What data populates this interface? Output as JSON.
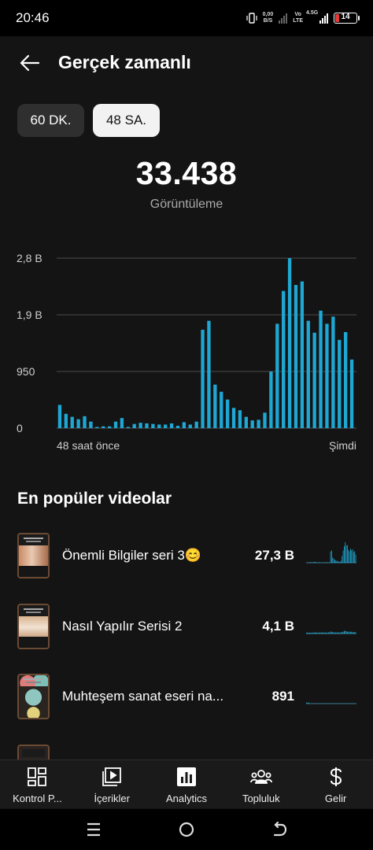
{
  "status_bar": {
    "time": "20:46",
    "net_speed_value": "0,00",
    "net_speed_unit": "B/S",
    "volte_top": "Vo",
    "volte_bottom": "LTE",
    "network_type": "4.5G",
    "battery_level": "14",
    "battery_color": "#e53935"
  },
  "header": {
    "back_icon": "arrow-left-icon",
    "title": "Gerçek zamanlı"
  },
  "range_chips": {
    "minutes_label": "60 DK.",
    "hours_label": "48 SA.",
    "selected": "48 SA."
  },
  "summary": {
    "total_views": "33.438",
    "total_views_label": "Görüntüleme"
  },
  "chart_data": {
    "type": "bar",
    "title": "",
    "xlabel": "",
    "ylabel": "",
    "x_start_label": "48 saat önce",
    "x_end_label": "Şimdi",
    "y_ticks": [
      {
        "label": "2,8 B",
        "value": 2850
      },
      {
        "label": "1,9 B",
        "value": 1900
      },
      {
        "label": "950",
        "value": 950
      },
      {
        "label": "0",
        "value": 0
      }
    ],
    "ylim": [
      0,
      2850
    ],
    "grid": true,
    "bar_color": "#1ea7d3",
    "values": [
      390,
      240,
      190,
      150,
      200,
      110,
      20,
      30,
      30,
      110,
      170,
      20,
      70,
      90,
      80,
      70,
      60,
      60,
      80,
      40,
      100,
      60,
      110,
      1650,
      1800,
      730,
      610,
      480,
      340,
      300,
      190,
      130,
      140,
      260,
      950,
      1750,
      2300,
      2850,
      2400,
      2460,
      1800,
      1600,
      1970,
      1750,
      1870,
      1480,
      1610,
      1150
    ],
    "series": [
      {
        "name": "",
        "values": []
      }
    ]
  },
  "popular": {
    "title": "En popüler videolar",
    "videos": [
      {
        "title": "Önemli Bilgiler seri 3😊",
        "views": "27,3 B",
        "spark": [
          0.02,
          0.02,
          0.02,
          0.03,
          0.03,
          0.02,
          0.02,
          0.05,
          0.04,
          0.03,
          0.02,
          0.02,
          0.03,
          0.02,
          0.02,
          0.02,
          0.02,
          0.02,
          0.02,
          0.03,
          0.02,
          0.02,
          0.02,
          0.55,
          0.6,
          0.25,
          0.2,
          0.15,
          0.1,
          0.1,
          0.08,
          0.04,
          0.05,
          0.09,
          0.33,
          0.6,
          0.8,
          1.0,
          0.85,
          0.86,
          0.63,
          0.56,
          0.69,
          0.61,
          0.66,
          0.52,
          0.57,
          0.4
        ]
      },
      {
        "title": "Nasıl Yapılır Serisi 2",
        "views": "4,1 B",
        "spark": [
          0.05,
          0.04,
          0.05,
          0.04,
          0.04,
          0.05,
          0.04,
          0.06,
          0.05,
          0.06,
          0.05,
          0.04,
          0.05,
          0.05,
          0.06,
          0.05,
          0.06,
          0.05,
          0.05,
          0.05,
          0.05,
          0.06,
          0.06,
          0.1,
          0.09,
          0.07,
          0.06,
          0.06,
          0.05,
          0.06,
          0.06,
          0.05,
          0.05,
          0.06,
          0.08,
          0.09,
          0.12,
          0.14,
          0.11,
          0.1,
          0.08,
          0.09,
          0.1,
          0.08,
          0.08,
          0.07,
          0.07,
          0.06
        ]
      },
      {
        "title": "Muhteşem sanat eseri na...",
        "views": "891",
        "spark": [
          0.05,
          0.04,
          0.06,
          0.02,
          0.02,
          0.02,
          0.02,
          0.02,
          0.02,
          0.02,
          0.02,
          0.02,
          0.02,
          0.02,
          0.02,
          0.02,
          0.02,
          0.02,
          0.02,
          0.02,
          0.02,
          0.02,
          0.02,
          0.02,
          0.02,
          0.02,
          0.02,
          0.02,
          0.02,
          0.02,
          0.02,
          0.02,
          0.02,
          0.02,
          0.02,
          0.02,
          0.02,
          0.02,
          0.02,
          0.02,
          0.02,
          0.02,
          0.02,
          0.02,
          0.02,
          0.02,
          0.02,
          0.02
        ]
      }
    ]
  },
  "bottom_nav": {
    "items": [
      {
        "label": "Kontrol P...",
        "icon": "dashboard-icon"
      },
      {
        "label": "İçerikler",
        "icon": "content-icon"
      },
      {
        "label": "Analytics",
        "icon": "analytics-icon"
      },
      {
        "label": "Topluluk",
        "icon": "community-icon"
      },
      {
        "label": "Gelir",
        "icon": "earn-icon"
      }
    ],
    "selected": "Analytics"
  },
  "system_nav": {
    "menu_icon": "menu-icon",
    "home_icon": "home-circle-icon",
    "back_icon": "back-arrow-icon"
  }
}
